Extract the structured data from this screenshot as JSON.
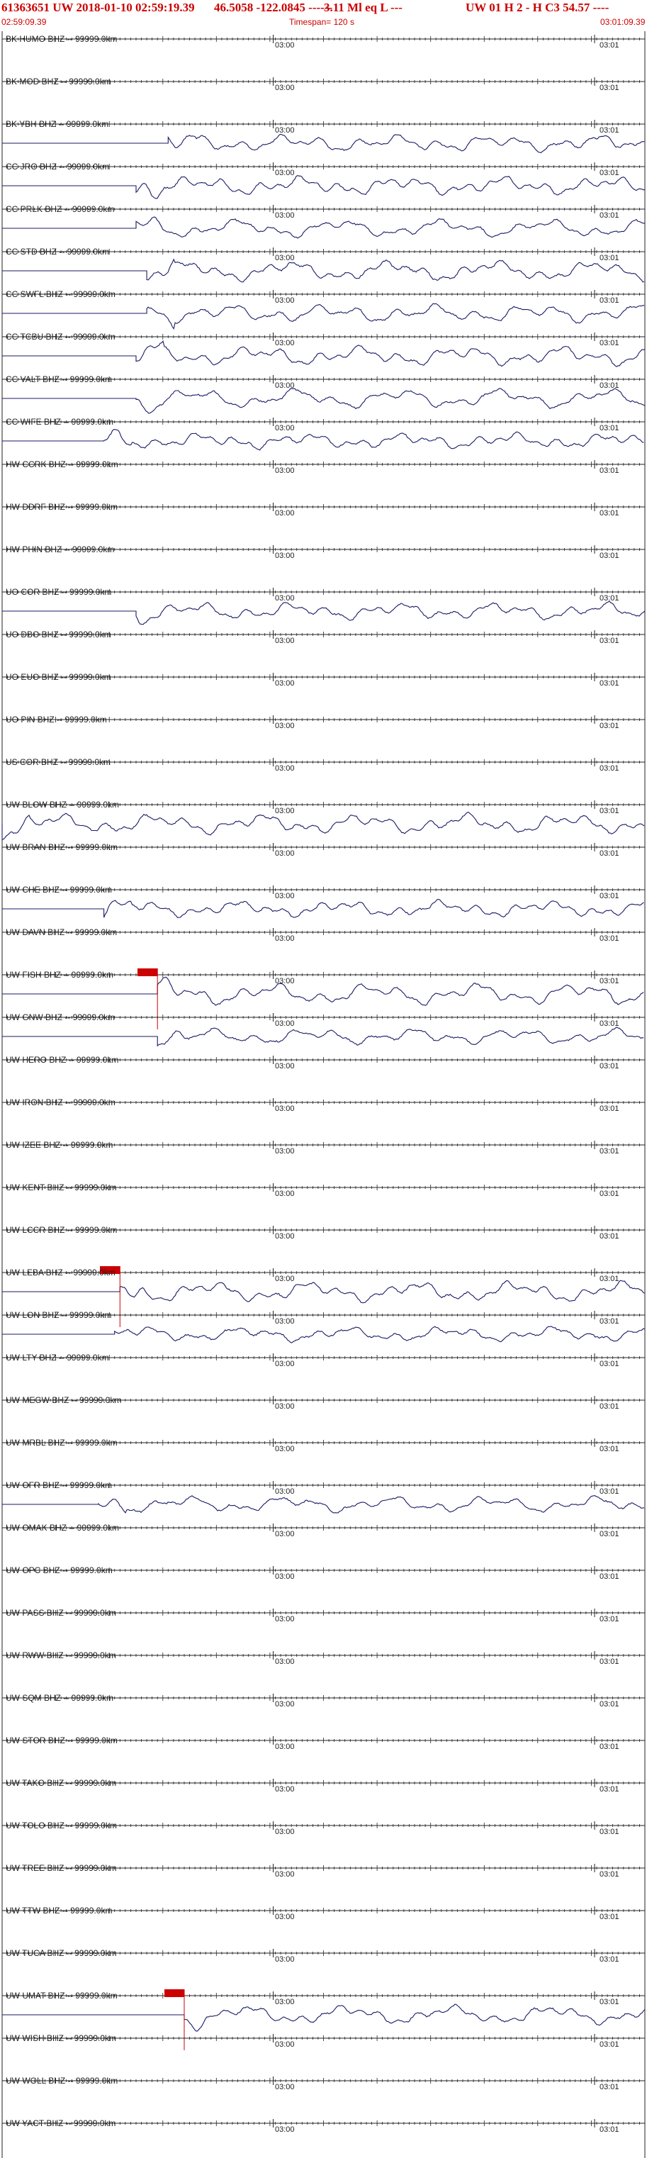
{
  "header": {
    "event_id": "61363651 UW 2018-01-10 02:59:19.39",
    "location": "46.5058 -122.0845 ------",
    "magnitude": "3.11 Ml eq L ---",
    "station_info": "UW 01 H 2 - H C3 54.57 ----",
    "start_time": "02:59:09.39",
    "timespan": "Timespan= 120 s",
    "end_time": "03:01:09.39"
  },
  "colors": {
    "header_text": "#cc0000",
    "trace": "#1a1a66",
    "axis": "#222222",
    "pick": "#cc0000",
    "pick_line": "#cc0000"
  },
  "tick_labels": {
    "mid": "03:00",
    "right": "03:01"
  },
  "chart_data": {
    "type": "line",
    "title": "61363651 UW 2018-01-10 02:59:19.39",
    "xlabel": "",
    "ylabel": "",
    "time_span_s": 120,
    "x_start": "02:59:09.39",
    "x_end": "03:01:09.39",
    "series": [
      {
        "name": "BK HUMO BHZ -- 99999.0km",
        "has_trace": false,
        "pick_time_s": null
      },
      {
        "name": "BK MOD BHZ -- 99999.0km",
        "has_trace": false,
        "pick_time_s": null
      },
      {
        "name": "BK YBH BHZ -- 99999.0km",
        "has_trace": true,
        "onset_s": 31,
        "pick_time_s": null
      },
      {
        "name": "CC JRO BHZ -- 99999.0km",
        "has_trace": true,
        "onset_s": 25,
        "pick_time_s": null
      },
      {
        "name": "CC PRLK BHZ -- 99999.0km",
        "has_trace": true,
        "onset_s": 25,
        "pick_time_s": null
      },
      {
        "name": "CC STD BHZ -- 99999.0km",
        "has_trace": true,
        "onset_s": 27,
        "pick_time_s": null
      },
      {
        "name": "CC SWFL BHZ -- 99999.0km",
        "has_trace": true,
        "onset_s": 27,
        "pick_time_s": null
      },
      {
        "name": "CC TCBU BHZ -- 99999.0km",
        "has_trace": true,
        "onset_s": 25,
        "pick_time_s": null
      },
      {
        "name": "CC VALT BHZ -- 99999.0km",
        "has_trace": true,
        "onset_s": 25,
        "pick_time_s": null
      },
      {
        "name": "CC WIFE BHZ -- 99999.0km",
        "has_trace": true,
        "onset_s": 19,
        "pick_time_s": null
      },
      {
        "name": "HW CCRK BHZ -- 99999.0km",
        "has_trace": false,
        "pick_time_s": null
      },
      {
        "name": "HW DDRF BHZ -- 99999.0km",
        "has_trace": false,
        "pick_time_s": null
      },
      {
        "name": "HW PHIN BHZ -- 99999.0km",
        "has_trace": false,
        "pick_time_s": null
      },
      {
        "name": "UO COR BHZ -- 99999.0km",
        "has_trace": true,
        "onset_s": 25,
        "pick_time_s": null
      },
      {
        "name": "UO DBO BHZ -- 99999.0km",
        "has_trace": false,
        "pick_time_s": null
      },
      {
        "name": "UO EUO BHZ -- 99999.0km",
        "has_trace": false,
        "pick_time_s": null
      },
      {
        "name": "UO PIN BHZ -- 99999.0km",
        "has_trace": false,
        "pick_time_s": null
      },
      {
        "name": "US COR BHZ -- 99999.0km",
        "has_trace": false,
        "pick_time_s": null
      },
      {
        "name": "UW BLOW BHZ -- 99999.0km",
        "has_trace": true,
        "onset_s": 0,
        "pick_time_s": null
      },
      {
        "name": "UW BRAN BHZ -- 99999.0km",
        "has_trace": false,
        "pick_time_s": null
      },
      {
        "name": "UW CHE BHZ -- 99999.0km",
        "has_trace": true,
        "onset_s": 19,
        "pick_time_s": null
      },
      {
        "name": "UW DAVN BHZ -- 99999.0km",
        "has_trace": false,
        "pick_time_s": null
      },
      {
        "name": "UW FISH BHZ -- 99999.0km",
        "has_trace": true,
        "onset_s": 29,
        "pick_time_s": 29
      },
      {
        "name": "UW GNW BHZ -- 99999.0km",
        "has_trace": true,
        "onset_s": 29,
        "pick_time_s": null
      },
      {
        "name": "UW HERO BHZ -- 99999.0km",
        "has_trace": false,
        "pick_time_s": null
      },
      {
        "name": "UW IRON BHZ -- 99999.0km",
        "has_trace": false,
        "pick_time_s": null
      },
      {
        "name": "UW IZEE BHZ -- 99999.0km",
        "has_trace": false,
        "pick_time_s": null
      },
      {
        "name": "UW KENT BHZ -- 99999.0km",
        "has_trace": false,
        "pick_time_s": null
      },
      {
        "name": "UW LCCR BHZ -- 99999.0km",
        "has_trace": false,
        "pick_time_s": null
      },
      {
        "name": "UW LEBA BHZ -- 99999.0km",
        "has_trace": true,
        "onset_s": 22,
        "pick_time_s": 22
      },
      {
        "name": "UW LON BHZ -- 99999.0km",
        "has_trace": true,
        "onset_s": 21,
        "pick_time_s": null
      },
      {
        "name": "UW LTY BHZ -- 99999.0km",
        "has_trace": false,
        "pick_time_s": null
      },
      {
        "name": "UW MEGW BHZ -- 99999.0km",
        "has_trace": false,
        "pick_time_s": null
      },
      {
        "name": "UW MRBL BHZ -- 99999.0km",
        "has_trace": false,
        "pick_time_s": null
      },
      {
        "name": "UW OFR BHZ -- 99999.0km",
        "has_trace": true,
        "onset_s": 18,
        "pick_time_s": null
      },
      {
        "name": "UW OMAK BHZ -- 99999.0km",
        "has_trace": false,
        "pick_time_s": null
      },
      {
        "name": "UW OPC BHZ -- 99999.0km",
        "has_trace": false,
        "pick_time_s": null
      },
      {
        "name": "UW PASS BHZ -- 99999.0km",
        "has_trace": false,
        "pick_time_s": null
      },
      {
        "name": "UW RWW BHZ -- 99999.0km",
        "has_trace": false,
        "pick_time_s": null
      },
      {
        "name": "UW SQM BHZ -- 99999.0km",
        "has_trace": false,
        "pick_time_s": null
      },
      {
        "name": "UW STOR BHZ -- 99999.0km",
        "has_trace": false,
        "pick_time_s": null
      },
      {
        "name": "UW TAKO BHZ -- 99999.0km",
        "has_trace": false,
        "pick_time_s": null
      },
      {
        "name": "UW TOLO BHZ -- 99999.0km",
        "has_trace": false,
        "pick_time_s": null
      },
      {
        "name": "UW TREE BHZ -- 99999.0km",
        "has_trace": false,
        "pick_time_s": null
      },
      {
        "name": "UW TTW BHZ -- 99999.0km",
        "has_trace": false,
        "pick_time_s": null
      },
      {
        "name": "UW TUCA BHZ -- 99999.0km",
        "has_trace": false,
        "pick_time_s": null
      },
      {
        "name": "UW UMAT BHZ -- 99999.0km",
        "has_trace": true,
        "onset_s": 34,
        "pick_time_s": 34
      },
      {
        "name": "UW WISH BHZ -- 99999.0km",
        "has_trace": false,
        "pick_time_s": null
      },
      {
        "name": "UW WOLL BHZ -- 99999.0km",
        "has_trace": false,
        "pick_time_s": null
      },
      {
        "name": "UW YACT BHZ -- 99999.0km",
        "has_trace": false,
        "pick_time_s": null
      }
    ]
  }
}
